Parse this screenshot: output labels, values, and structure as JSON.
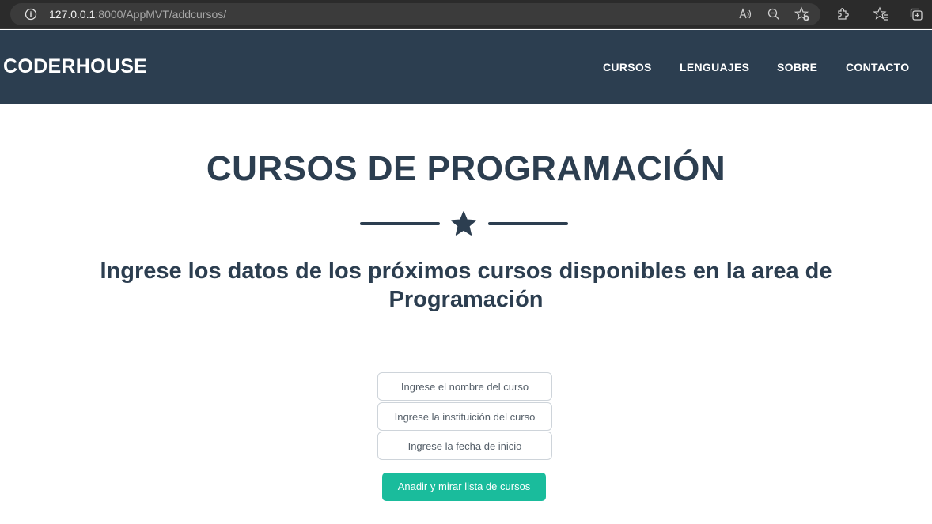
{
  "browser": {
    "url_host": "127.0.0.1",
    "url_rest": ":8000/AppMVT/addcursos/",
    "icons": [
      "info-icon",
      "read-aloud-icon",
      "zoom-out-icon",
      "favorite-add-icon",
      "extensions-icon",
      "favorites-icon",
      "collections-icon"
    ]
  },
  "navbar": {
    "brand": "CODERHOUSE",
    "links": [
      "CURSOS",
      "LENGUAJES",
      "SOBRE",
      "CONTACTO"
    ],
    "background": "#2c3e50"
  },
  "main": {
    "title": "CURSOS DE PROGRAMACIÓN",
    "subtitle": "Ingrese los datos de los próximos cursos disponibles en la area de Programación",
    "accent_color": "#2c3e50"
  },
  "form": {
    "fields": [
      {
        "placeholder": "Ingrese el nombre del curso",
        "value": ""
      },
      {
        "placeholder": "Ingrese la instituición del curso",
        "value": ""
      },
      {
        "placeholder": "Ingrese la fecha de inicio",
        "value": ""
      }
    ],
    "submit_label": "Anadir y mirar lista de cursos",
    "submit_color": "#1abc9c"
  }
}
